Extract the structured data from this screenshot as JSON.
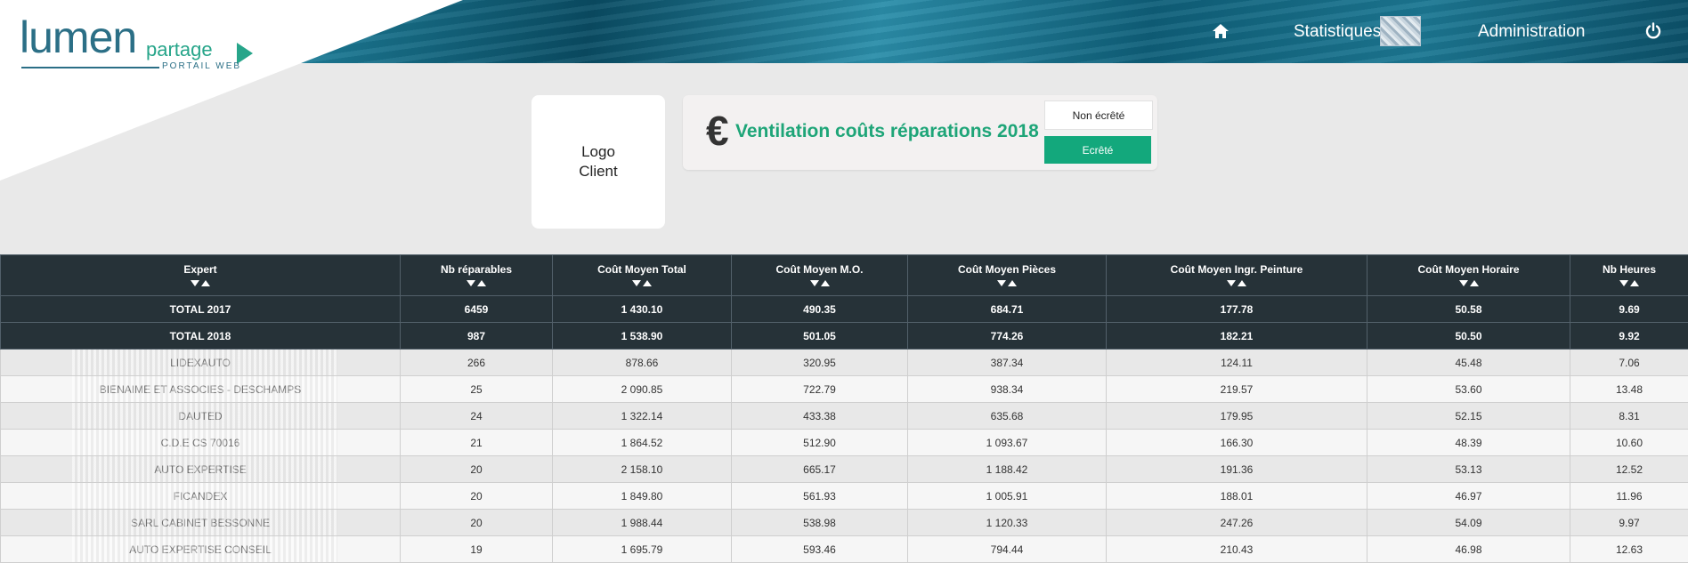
{
  "brand": {
    "logo_main": "lumen",
    "logo_sub": "partage",
    "logo_tagline": "PORTAIL WEB"
  },
  "nav": {
    "home_icon": "home-icon",
    "stats": "Statistiques",
    "admin": "Administration",
    "power_icon": "power-icon"
  },
  "client_logo": {
    "line1": "Logo",
    "line2": "Client"
  },
  "panel": {
    "currency_symbol": "€",
    "title": "Ventilation coûts réparations 2018",
    "btn_non_ecrete": "Non écrêté",
    "btn_ecrete": "Ecrêté"
  },
  "colors": {
    "header_teal": "#0d5a73",
    "accent_green": "#13a87c",
    "table_header": "#263238"
  },
  "table": {
    "columns": [
      "Expert",
      "Nb réparables",
      "Coût Moyen Total",
      "Coût Moyen M.O.",
      "Coût Moyen Pièces",
      "Coût Moyen Ingr. Peinture",
      "Coût Moyen Horaire",
      "Nb Heures"
    ],
    "totals": [
      [
        "TOTAL 2017",
        "6459",
        "1 430.10",
        "490.35",
        "684.71",
        "177.78",
        "50.58",
        "9.69"
      ],
      [
        "TOTAL 2018",
        "987",
        "1 538.90",
        "501.05",
        "774.26",
        "182.21",
        "50.50",
        "9.92"
      ]
    ],
    "rows": [
      [
        "LIDEXAUTO",
        "266",
        "878.66",
        "320.95",
        "387.34",
        "124.11",
        "45.48",
        "7.06"
      ],
      [
        "BIENAIME ET ASSOCIES - DESCHAMPS",
        "25",
        "2 090.85",
        "722.79",
        "938.34",
        "219.57",
        "53.60",
        "13.48"
      ],
      [
        "DAUTED",
        "24",
        "1 322.14",
        "433.38",
        "635.68",
        "179.95",
        "52.15",
        "8.31"
      ],
      [
        "C.D.E CS 70016",
        "21",
        "1 864.52",
        "512.90",
        "1 093.67",
        "166.30",
        "48.39",
        "10.60"
      ],
      [
        "AUTO EXPERTISE",
        "20",
        "2 158.10",
        "665.17",
        "1 188.42",
        "191.36",
        "53.13",
        "12.52"
      ],
      [
        "FICANDEX",
        "20",
        "1 849.80",
        "561.93",
        "1 005.91",
        "188.01",
        "46.97",
        "11.96"
      ],
      [
        "SARL CABINET BESSONNE",
        "20",
        "1 988.44",
        "538.98",
        "1 120.33",
        "247.26",
        "54.09",
        "9.97"
      ],
      [
        "AUTO EXPERTISE CONSEIL",
        "19",
        "1 695.79",
        "593.46",
        "794.44",
        "210.43",
        "46.98",
        "12.63"
      ]
    ]
  }
}
